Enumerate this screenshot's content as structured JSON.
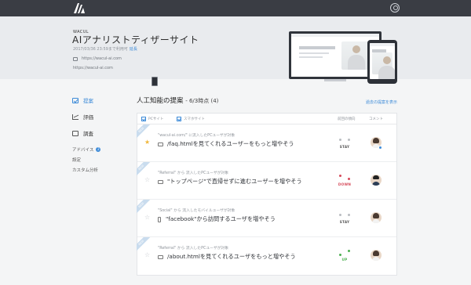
{
  "header": {
    "logo": "wacul-logo",
    "user_icon": "user-circle-icon"
  },
  "site": {
    "brand": "WACUL",
    "title": "AIアナリストティザーサイト",
    "availability": "2017/03/36 23:59まで利用可",
    "extend_link": "延長",
    "urls": [
      {
        "icon": "desktop-icon",
        "text": "https://wacul-ai.com"
      },
      {
        "icon": "mobile-icon",
        "text": "https://wacul-ai.com"
      }
    ]
  },
  "sidebar": {
    "items": [
      {
        "label": "提案",
        "icon": "check-icon",
        "active": true
      },
      {
        "label": "評価",
        "icon": "chart-icon",
        "active": false
      },
      {
        "label": "調査",
        "icon": "search-icon",
        "active": false
      }
    ],
    "sub_items": [
      {
        "label": "アドバイス",
        "badge": "2"
      },
      {
        "label": "設定"
      },
      {
        "label": "カスタム分析"
      }
    ]
  },
  "proposals": {
    "title": "人工知能の提案",
    "count_text": "- 6/3時点 (4)",
    "show_all": "過去の提案を表示",
    "filters": [
      {
        "label": "PCサイト",
        "checked": true
      },
      {
        "label": "スマホサイト",
        "checked": true
      }
    ],
    "col_trend": "前回の傾向",
    "col_comment": "コメント",
    "rows": [
      {
        "ribbon": "NEW",
        "starred": true,
        "source": "\"wacul-ai.com/\" に流入したPCユーザが対象",
        "device": "pc",
        "headline": "/faq.htmlを見てくれるユーザーをもっと増やそう",
        "trend": "STAY",
        "trend_color": "#555555",
        "avatar": "woman",
        "avatar_badge": true
      },
      {
        "ribbon": "NEW",
        "starred": false,
        "source": "\"Referral\" から 流入したPCユーザが対象",
        "device": "pc",
        "headline": "\"トップページ\"で直帰せずに進むユーザーを増やそう",
        "trend": "DOWN",
        "trend_color": "#d64a5a",
        "avatar": "man",
        "avatar_badge": false
      },
      {
        "ribbon": "NEW",
        "starred": false,
        "source": "\"Social\" から 流入したモバイルユーザが対象",
        "device": "sp",
        "headline": "\"facebook\"から訪問するユーザを増やそう",
        "trend": "STAY",
        "trend_color": "#555555",
        "avatar": "woman",
        "avatar_badge": false
      },
      {
        "ribbon": "NEW",
        "starred": false,
        "source": "\"Referral\" から 流入したPCユーザが対象",
        "device": "pc",
        "headline": "/about.htmlを見てくれるユーザをもっと増やそう",
        "trend": "UP",
        "trend_color": "#4cb050",
        "avatar": "woman",
        "avatar_badge": false
      }
    ]
  }
}
